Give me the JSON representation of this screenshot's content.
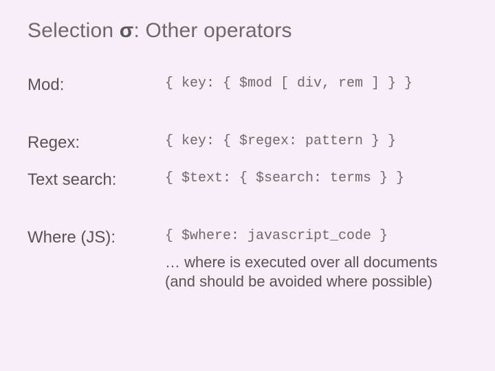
{
  "title": {
    "pre": "Selection ",
    "sigma": "σ",
    "post": ": Other operators"
  },
  "rows": {
    "mod": {
      "label": "Mod:",
      "code": "{ key: { $mod [ div, rem ] } }"
    },
    "regex": {
      "label": "Regex:",
      "code": "{ key: { $regex: pattern } }"
    },
    "text": {
      "label": "Text search:",
      "code": "{ $text: { $search: terms } }"
    },
    "where": {
      "label": "Where (JS):",
      "code": "{ $where: javascript_code }"
    }
  },
  "note": {
    "prefix": "… ",
    "kw": "where",
    "rest": " is executed over all documents (and should be avoided where possible)"
  }
}
